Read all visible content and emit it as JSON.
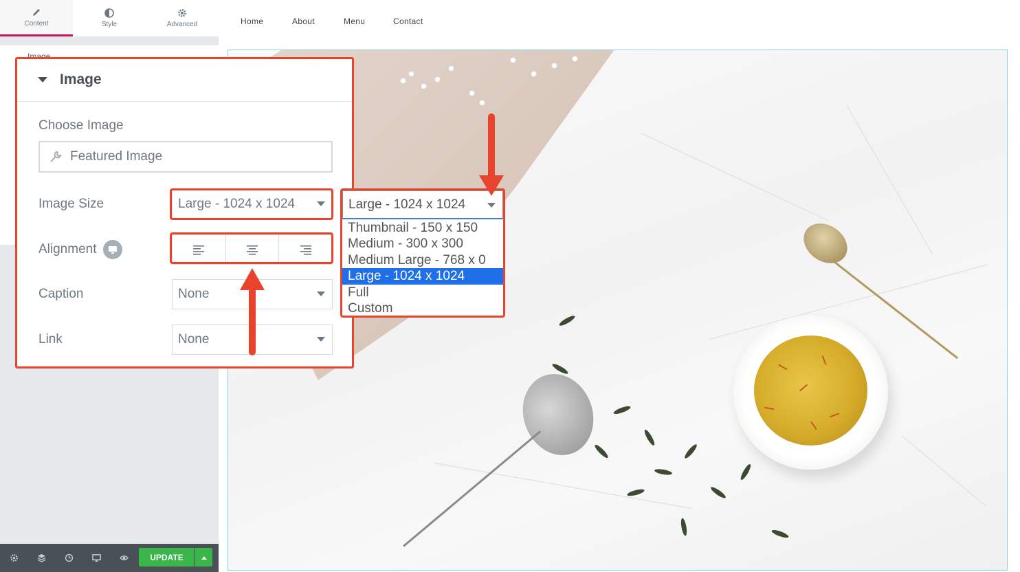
{
  "panel": {
    "tabs": [
      {
        "label": "Content",
        "icon": "pencil-icon"
      },
      {
        "label": "Style",
        "icon": "half-circle-icon"
      },
      {
        "label": "Advanced",
        "icon": "gear-icon"
      }
    ],
    "section_title": "Image",
    "bottom_bar": {
      "icons": [
        "gear-icon",
        "layers-icon",
        "history-icon",
        "desktop-icon",
        "eye-icon"
      ],
      "update_label": "UPDATE"
    }
  },
  "site_nav": [
    "Home",
    "About",
    "Menu",
    "Contact"
  ],
  "zoom": {
    "title": "Image",
    "choose_image_label": "Choose Image",
    "choose_image_value": "Featured Image",
    "image_size_label": "Image Size",
    "image_size_value": "Large - 1024 x 1024",
    "alignment_label": "Alignment",
    "caption_label": "Caption",
    "caption_value": "None",
    "link_label": "Link",
    "link_value": "None"
  },
  "dropdown": {
    "current": "Large - 1024 x 1024",
    "options": [
      "Thumbnail - 150 x 150",
      "Medium - 300 x 300",
      "Medium Large - 768 x 0",
      "Large - 1024 x 1024",
      "Full",
      "Custom"
    ],
    "selected_index": 3
  },
  "colors": {
    "accent_red": "#e8432d",
    "update_green": "#39b54a",
    "selection_blue": "#1e6fe8",
    "tab_active": "#c2185b"
  }
}
